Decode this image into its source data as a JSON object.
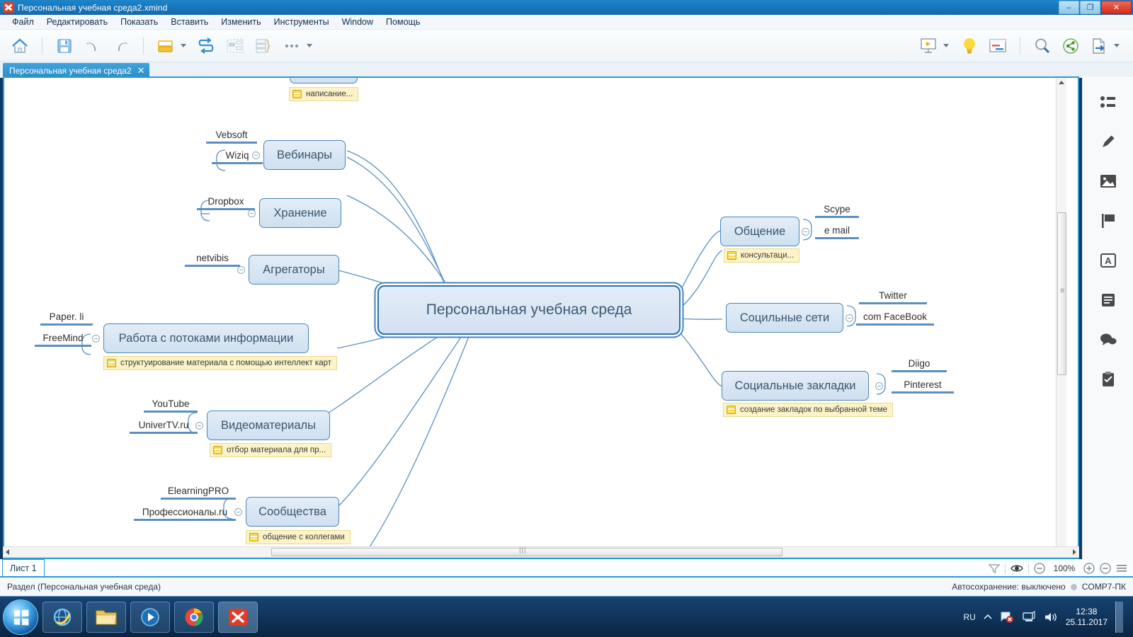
{
  "window": {
    "title": "Персональная учебная среда2.xmind",
    "app_icon": "xmind-icon",
    "minimize": "–",
    "maximize": "❐",
    "close": "✕"
  },
  "menu": {
    "items": [
      {
        "label": "Файл",
        "name": "menu-file"
      },
      {
        "label": "Редактировать",
        "name": "menu-edit"
      },
      {
        "label": "Показать",
        "name": "menu-view"
      },
      {
        "label": "Вставить",
        "name": "menu-insert"
      },
      {
        "label": "Изменить",
        "name": "menu-modify"
      },
      {
        "label": "Инструменты",
        "name": "menu-tools"
      },
      {
        "label": "Window",
        "name": "menu-window"
      },
      {
        "label": "Помощь",
        "name": "menu-help"
      }
    ]
  },
  "toolbar": {
    "left": [
      {
        "name": "home-icon",
        "title": "Домой"
      },
      {
        "name": "save-icon",
        "title": "Сохранить"
      },
      {
        "name": "undo-icon",
        "title": "Отменить"
      },
      {
        "name": "redo-icon",
        "title": "Вернуть"
      },
      {
        "name": "topic-icon",
        "title": "Тема"
      },
      {
        "name": "relationship-icon",
        "title": "Связь"
      },
      {
        "name": "boundary-icon",
        "title": "Граница"
      },
      {
        "name": "summary-icon",
        "title": "Сводка"
      },
      {
        "name": "more-icon",
        "title": "Ещё"
      }
    ],
    "right": [
      {
        "name": "presentation-icon",
        "title": "Презентация"
      },
      {
        "name": "brainstorm-icon",
        "title": "Мозговой штурм"
      },
      {
        "name": "gantt-icon",
        "title": "Диаграмма Ганта"
      },
      {
        "name": "search-icon",
        "title": "Поиск"
      },
      {
        "name": "share-icon",
        "title": "Поделиться"
      },
      {
        "name": "export-icon",
        "title": "Экспорт"
      }
    ]
  },
  "tab": {
    "label": "Персональная учебная среда2",
    "close": "✕"
  },
  "rail": {
    "items": [
      {
        "name": "outline-icon",
        "title": "Структура"
      },
      {
        "name": "style-brush-icon",
        "title": "Стиль"
      },
      {
        "name": "image-icon",
        "title": "Изображение"
      },
      {
        "name": "marker-flag-icon",
        "title": "Маркер"
      },
      {
        "name": "text-icon",
        "title": "Текст"
      },
      {
        "name": "notes-icon",
        "title": "Заметки"
      },
      {
        "name": "comments-icon",
        "title": "Комментарии"
      },
      {
        "name": "clipboard-icon",
        "title": "Задачи"
      }
    ]
  },
  "map": {
    "central": {
      "label": "Персональная учебная среда",
      "selected": true
    },
    "branches": [
      {
        "label": "Вебинары",
        "side": "left",
        "name": "node-webinars",
        "children": [
          "Vebsoft",
          "Wiziq"
        ],
        "note": null
      },
      {
        "label": "Хранение",
        "side": "left",
        "name": "node-storage",
        "children": [
          "Dropbox"
        ],
        "note": null
      },
      {
        "label": "Агрегаторы",
        "side": "left",
        "name": "node-aggregators",
        "children": [
          "netvibis"
        ],
        "note": null
      },
      {
        "label": "Работа с потоками информации",
        "side": "left",
        "name": "node-info-flows",
        "children": [
          "Paper. li",
          "FreeMind"
        ],
        "note": "структуирование материала с помощью интеллект карт"
      },
      {
        "label": "Видеоматериалы",
        "side": "left",
        "name": "node-video",
        "children": [
          "YouTube",
          "UniverTV.ru"
        ],
        "note": "отбор материала для пр..."
      },
      {
        "label": "Сообщества",
        "side": "left",
        "name": "node-communities",
        "children": [
          "ElearningPRO",
          "Профессионалы.ru"
        ],
        "note": "общение с коллегами"
      },
      {
        "label": "Общение",
        "side": "right",
        "name": "node-communication",
        "children": [
          "Scype",
          "e mail"
        ],
        "note": "консультаци..."
      },
      {
        "label": "Социльные сети",
        "side": "right",
        "name": "node-social-networks",
        "children": [
          "Twitter",
          "com FaceBook"
        ],
        "note": null
      },
      {
        "label": "Социальные закладки",
        "side": "right",
        "name": "node-social-bookmarks",
        "children": [
          "Diigo",
          "Pinterest"
        ],
        "note": "создание закладок по выбранной теме"
      }
    ],
    "top_partial_note": "написание..."
  },
  "sheet": {
    "tab_label": "Лист 1"
  },
  "zoom": {
    "level": "100%",
    "minus": "−",
    "plus": "+"
  },
  "status": {
    "left": "Раздел (Персональная учебная среда)",
    "autosave": "Автосохранение: выключено",
    "computer": "COMP7-ПК"
  },
  "taskbar": {
    "apps": [
      {
        "name": "taskbar-explorer-icon",
        "title": "Internet Explorer"
      },
      {
        "name": "taskbar-folder-icon",
        "title": "Проводник"
      },
      {
        "name": "taskbar-media-icon",
        "title": "Проигрыватель"
      },
      {
        "name": "taskbar-chrome-icon",
        "title": "Google Chrome"
      },
      {
        "name": "taskbar-xmind-icon",
        "title": "XMind"
      }
    ],
    "language": "RU",
    "time": "12:38",
    "date": "25.11.2017"
  },
  "colors": {
    "accent": "#2e9ad4",
    "node_border": "#4a86b8",
    "node_fill": "#dce8f5",
    "note_bg": "#fcf3c8",
    "leaf_underline": "#5b8fc0"
  }
}
